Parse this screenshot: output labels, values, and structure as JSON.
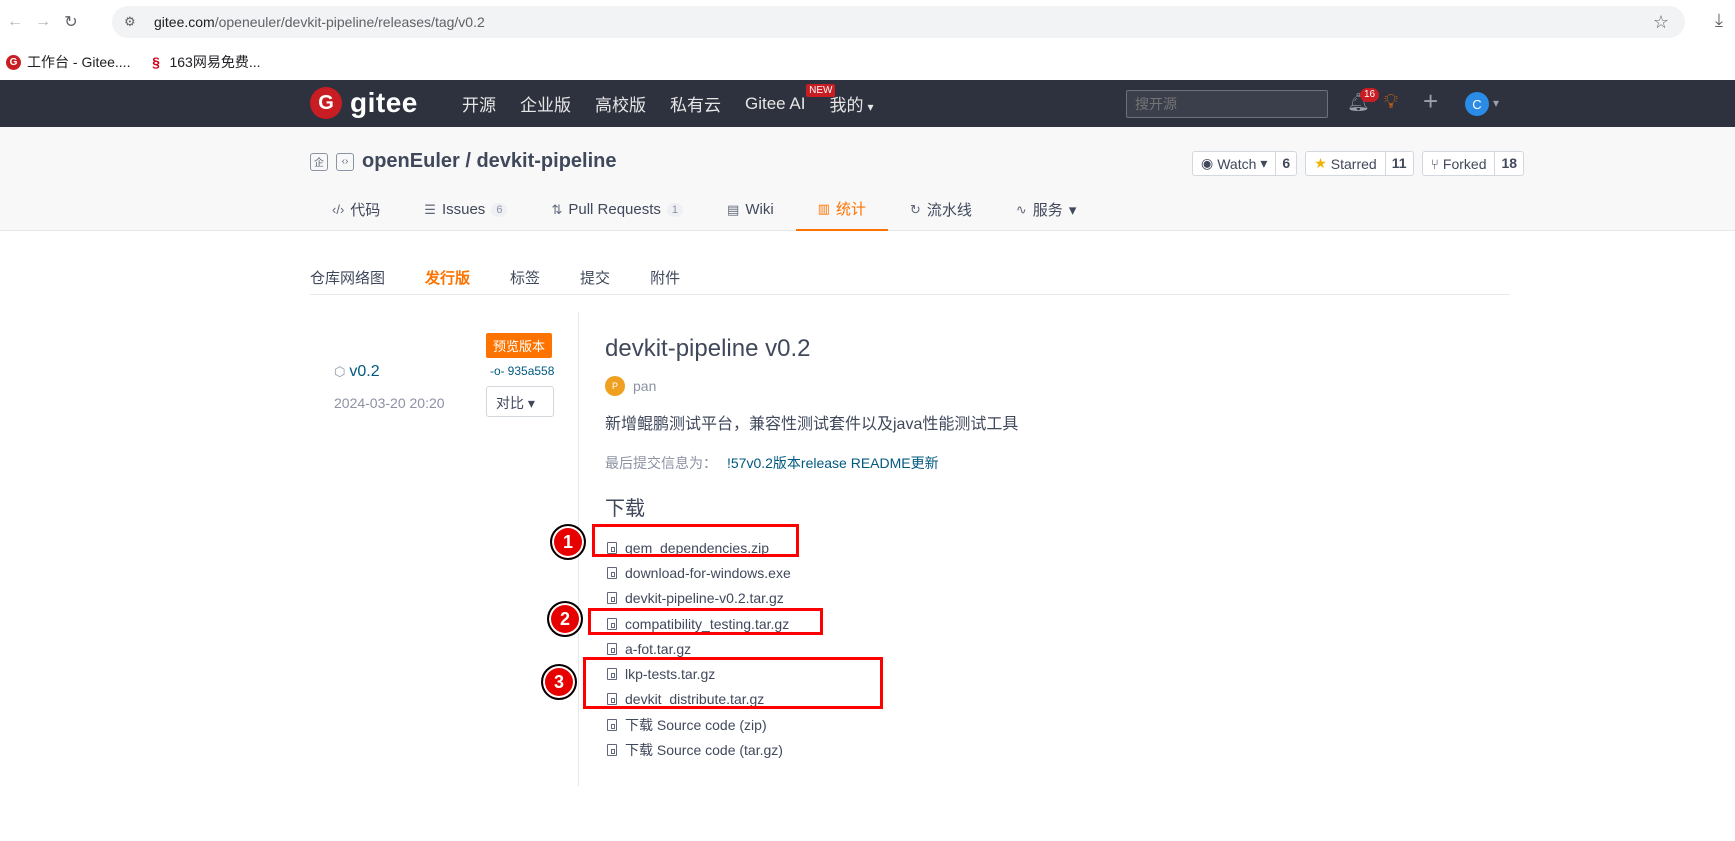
{
  "browser": {
    "url_host": "gitee.com",
    "url_path": "/openeuler/devkit-pipeline/releases/tag/v0.2",
    "bookmarks": [
      {
        "label": "工作台 - Gitee...."
      },
      {
        "label": "163网易免费..."
      }
    ]
  },
  "header": {
    "logo_text": "gitee",
    "nav": [
      "开源",
      "企业版",
      "高校版",
      "私有云",
      "Gitee AI",
      "我的"
    ],
    "new_badge": "NEW",
    "search_placeholder": "搜开源",
    "notification_count": "16",
    "avatar_letter": "C"
  },
  "repo": {
    "title": "openEuler / devkit-pipeline",
    "watch_label": "Watch",
    "watch_count": "6",
    "star_label": "Starred",
    "star_count": "11",
    "fork_label": "Forked",
    "fork_count": "18",
    "tabs": [
      {
        "label": "代码",
        "icon": "code-icon"
      },
      {
        "label": "Issues",
        "icon": "issues-icon",
        "count": "6"
      },
      {
        "label": "Pull Requests",
        "icon": "pull-request-icon",
        "count": "1"
      },
      {
        "label": "Wiki",
        "icon": "wiki-icon"
      },
      {
        "label": "统计",
        "icon": "stats-icon",
        "active": true
      },
      {
        "label": "流水线",
        "icon": "pipeline-icon"
      },
      {
        "label": "服务",
        "icon": "service-icon"
      }
    ]
  },
  "subnav": [
    "仓库网络图",
    "发行版",
    "标签",
    "提交",
    "附件"
  ],
  "release": {
    "tag": "v0.2",
    "date": "2024-03-20 20:20",
    "prerelease_badge": "预览版本",
    "commit": "935a558",
    "compare_label": "对比",
    "title": "devkit-pipeline v0.2",
    "author": "pan",
    "author_avatar_letter": "P",
    "description": "新增鲲鹏测试平台，兼容性测试套件以及java性能测试工具",
    "last_commit_label": "最后提交信息为：",
    "last_commit_text": "!57v0.2版本release README更新",
    "download_heading": "下载",
    "downloads": [
      "gem_dependencies.zip",
      "download-for-windows.exe",
      "devkit-pipeline-v0.2.tar.gz",
      "compatibility_testing.tar.gz",
      "a-fot.tar.gz",
      "lkp-tests.tar.gz",
      "devkit_distribute.tar.gz",
      "下载 Source code (zip)",
      "下载 Source code (tar.gz)"
    ]
  },
  "annotations": {
    "markers": [
      "1",
      "2",
      "3"
    ],
    "color": "#ff0000"
  },
  "colors": {
    "accent": "#fe7300",
    "header_bg": "#2e323e",
    "link": "#005980",
    "brand_red": "#c71d23"
  }
}
